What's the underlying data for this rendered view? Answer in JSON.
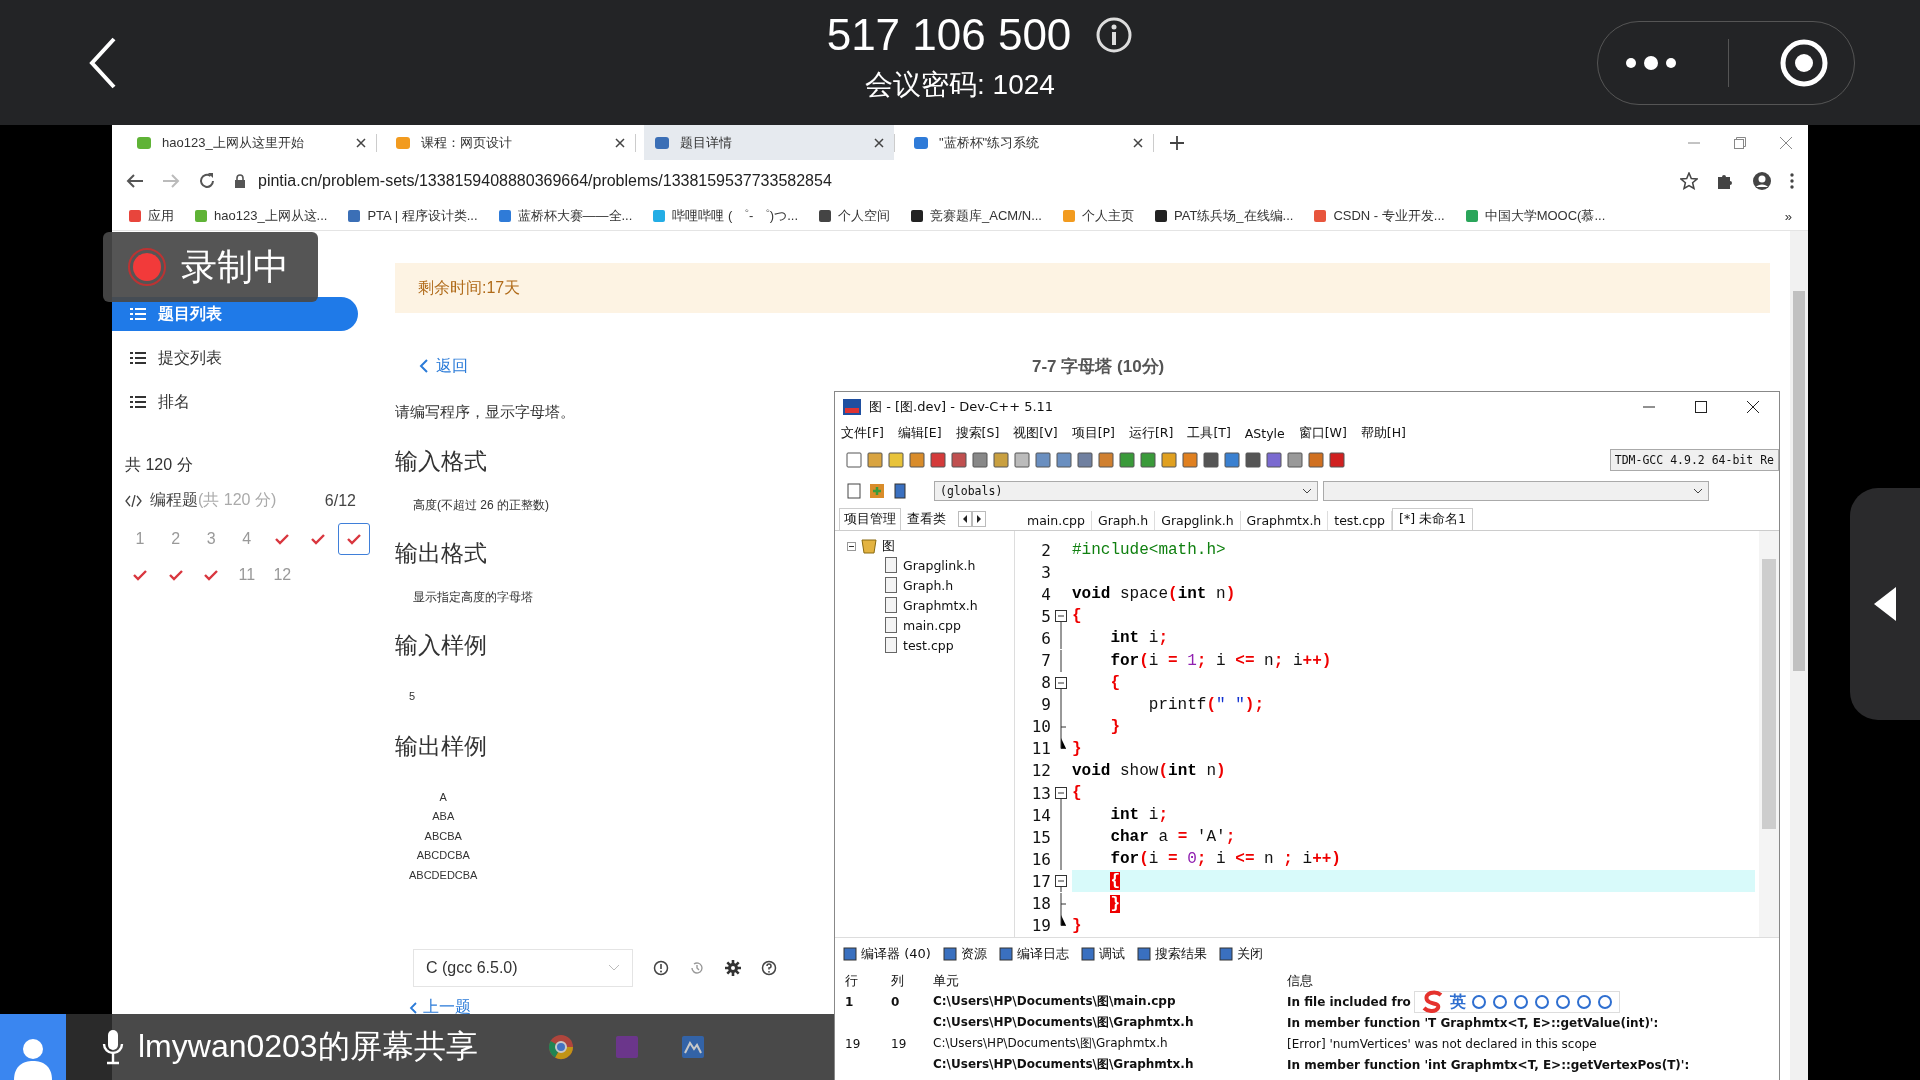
{
  "meeting": {
    "number": "517 106 500",
    "password": "会议密码: 1024"
  },
  "recording": {
    "label": "录制中"
  },
  "browser": {
    "tabs": [
      {
        "title": "hao123_上网从这里开始",
        "selected": false
      },
      {
        "title": "课程：网页设计",
        "selected": false
      },
      {
        "title": "题目详情",
        "selected": true
      },
      {
        "title": "\"蓝桥杯\"练习系统",
        "selected": false
      }
    ],
    "url": "pintia.cn/problem-sets/1338159408880369664/problems/1338159537733582854",
    "bookmarks": [
      {
        "title": "应用",
        "color": "#e8453c"
      },
      {
        "title": "hao123_上网从这...",
        "color": "#5fb336"
      },
      {
        "title": "PTA | 程序设计类...",
        "color": "#3b6fb6"
      },
      {
        "title": "蓝桥杯大赛——全...",
        "color": "#2f7bd8"
      },
      {
        "title": "哔哩哔哩 ( ゜- ゜)つ...",
        "color": "#23ade5"
      },
      {
        "title": "个人空间",
        "color": "#444444"
      },
      {
        "title": "竞赛题库_ACM/N...",
        "color": "#222222"
      },
      {
        "title": "个人主页",
        "color": "#f29b1f"
      },
      {
        "title": "PAT练兵场_在线编...",
        "color": "#222222"
      },
      {
        "title": "CSDN - 专业开发...",
        "color": "#e8553d"
      },
      {
        "title": "中国大学MOOC(慕...",
        "color": "#2aa55a"
      }
    ],
    "more": "»"
  },
  "sidebar": {
    "items": [
      {
        "label": "题目列表",
        "selected": true
      },
      {
        "label": "提交列表",
        "selected": false
      },
      {
        "label": "排名",
        "selected": false
      }
    ],
    "total": "共 120 分",
    "section": {
      "title": "编程题",
      "score": "(共 120 分)",
      "progress": "6/12"
    },
    "problems": [
      {
        "label": "1",
        "solved": false,
        "selected": false
      },
      {
        "label": "2",
        "solved": false,
        "selected": false
      },
      {
        "label": "3",
        "solved": false,
        "selected": false
      },
      {
        "label": "4",
        "solved": false,
        "selected": false
      },
      {
        "solved": true,
        "selected": false
      },
      {
        "solved": true,
        "selected": false
      },
      {
        "solved": true,
        "selected": true
      },
      {
        "solved": true,
        "selected": false
      },
      {
        "solved": true,
        "selected": false
      },
      {
        "solved": true,
        "selected": false
      },
      {
        "label": "11",
        "solved": false,
        "selected": false
      },
      {
        "label": "12",
        "solved": false,
        "selected": false
      }
    ]
  },
  "problem": {
    "notice": "剩余时间:17天",
    "back": "返回",
    "title": "7-7 字母塔 (10分)",
    "description": "请编写程序，显示字母塔。",
    "sections": [
      {
        "heading": "输入格式",
        "kind": "text",
        "lines": [
          "高度(不超过 26 的正整数)"
        ]
      },
      {
        "heading": "输出格式",
        "kind": "text",
        "lines": [
          "显示指定高度的字母塔"
        ]
      },
      {
        "heading": "输入样例",
        "kind": "sample",
        "lines": [
          "5"
        ]
      },
      {
        "heading": "输出样例",
        "kind": "sample",
        "lines": [
          "A",
          "ABA",
          "ABCBA",
          "ABCDCBA",
          "ABCDEDCBA"
        ]
      }
    ],
    "language": "C (gcc 6.5.0)",
    "prev": "上一题"
  },
  "devcpp": {
    "title": "图 - [图.dev] - Dev-C++ 5.11",
    "menu": [
      "文件[F]",
      "编辑[E]",
      "搜索[S]",
      "视图[V]",
      "项目[P]",
      "运行[R]",
      "工具[T]",
      "AStyle",
      "窗口[W]",
      "帮助[H]"
    ],
    "compiler": "TDM-GCC 4.9.2 64-bit Re",
    "scope": "(globals)",
    "panel_tabs": [
      {
        "label": "项目管理",
        "selected": true
      },
      {
        "label": "查看类",
        "selected": false
      }
    ],
    "file_tabs": [
      {
        "label": "main.cpp",
        "selected": false
      },
      {
        "label": "Graph.h",
        "selected": false
      },
      {
        "label": "Grapglink.h",
        "selected": false
      },
      {
        "label": "Graphmtx.h",
        "selected": false
      },
      {
        "label": "test.cpp",
        "selected": false
      },
      {
        "label": "[*] 未命名1",
        "selected": true
      }
    ],
    "tree": {
      "label": "图",
      "expanded": true,
      "children": [
        {
          "label": "Grapglink.h"
        },
        {
          "label": "Graph.h"
        },
        {
          "label": "Graphmtx.h"
        },
        {
          "label": "main.cpp"
        },
        {
          "label": "test.cpp"
        }
      ]
    },
    "code": [
      {
        "number": "2",
        "current": false,
        "tokens": [
          {
            "kind": "pre",
            "text": "#include<math.h>"
          }
        ]
      },
      {
        "number": "3",
        "current": false
      },
      {
        "number": "4",
        "current": false,
        "tokens": [
          {
            "kind": "kw",
            "text": "void"
          },
          {
            "kind": "id",
            "text": " space"
          },
          {
            "kind": "sym",
            "text": "("
          },
          {
            "kind": "kw",
            "text": "int"
          },
          {
            "kind": "id",
            "text": " n"
          },
          {
            "kind": "sym",
            "text": ")"
          }
        ]
      },
      {
        "number": "5",
        "kind": "open",
        "current": false,
        "tokens": [
          {
            "kind": "sym",
            "text": "{"
          }
        ]
      },
      {
        "number": "6",
        "kind": "line",
        "current": false,
        "tokens": [
          {
            "kind": "kw",
            "text": "    int"
          },
          {
            "kind": "id",
            "text": " i"
          },
          {
            "kind": "sym",
            "text": ";"
          }
        ]
      },
      {
        "number": "7",
        "kind": "line",
        "current": false,
        "tokens": [
          {
            "kind": "kw",
            "text": "    for"
          },
          {
            "kind": "sym",
            "text": "("
          },
          {
            "kind": "id",
            "text": "i "
          },
          {
            "kind": "sym",
            "text": "="
          },
          {
            "kind": "num",
            "text": " 1"
          },
          {
            "kind": "sym",
            "text": ";"
          },
          {
            "kind": "id",
            "text": " i "
          },
          {
            "kind": "sym",
            "text": "<="
          },
          {
            "kind": "id",
            "text": " n"
          },
          {
            "kind": "sym",
            "text": ";"
          },
          {
            "kind": "id",
            "text": " i"
          },
          {
            "kind": "sym",
            "text": "++"
          },
          {
            "kind": "sym",
            "text": ")"
          }
        ]
      },
      {
        "number": "8",
        "kind": "open",
        "current": false,
        "tokens": [
          {
            "kind": "sym",
            "text": "    {"
          }
        ]
      },
      {
        "number": "9",
        "kind": "line",
        "current": false,
        "tokens": [
          {
            "kind": "id",
            "text": "        printf"
          },
          {
            "kind": "sym",
            "text": "("
          },
          {
            "kind": "str",
            "text": "\" \""
          },
          {
            "kind": "sym",
            "text": ")"
          },
          {
            "kind": "sym",
            "text": ";"
          }
        ]
      },
      {
        "number": "10",
        "kind": "mid",
        "current": false,
        "tokens": [
          {
            "kind": "sym",
            "text": "    }"
          }
        ]
      },
      {
        "number": "11",
        "kind": "end",
        "current": false,
        "tokens": [
          {
            "kind": "sym",
            "text": "}"
          }
        ]
      },
      {
        "number": "12",
        "current": false,
        "tokens": [
          {
            "kind": "kw",
            "text": "void"
          },
          {
            "kind": "id",
            "text": " show"
          },
          {
            "kind": "sym",
            "text": "("
          },
          {
            "kind": "kw",
            "text": "int"
          },
          {
            "kind": "id",
            "text": " n"
          },
          {
            "kind": "sym",
            "text": ")"
          }
        ]
      },
      {
        "number": "13",
        "kind": "open",
        "current": false,
        "tokens": [
          {
            "kind": "sym",
            "text": "{"
          }
        ]
      },
      {
        "number": "14",
        "kind": "line",
        "current": false,
        "tokens": [
          {
            "kind": "kw",
            "text": "    int"
          },
          {
            "kind": "id",
            "text": " i"
          },
          {
            "kind": "sym",
            "text": ";"
          }
        ]
      },
      {
        "number": "15",
        "kind": "line",
        "current": false,
        "tokens": [
          {
            "kind": "kw",
            "text": "    char"
          },
          {
            "kind": "id",
            "text": " a "
          },
          {
            "kind": "sym",
            "text": "="
          },
          {
            "kind": "id",
            "text": " 'A'"
          },
          {
            "kind": "sym",
            "text": ";"
          }
        ]
      },
      {
        "number": "16",
        "kind": "line",
        "current": false,
        "tokens": [
          {
            "kind": "kw",
            "text": "    for"
          },
          {
            "kind": "sym",
            "text": "("
          },
          {
            "kind": "id",
            "text": "i "
          },
          {
            "kind": "sym",
            "text": "="
          },
          {
            "kind": "num",
            "text": " 0"
          },
          {
            "kind": "sym",
            "text": ";"
          },
          {
            "kind": "id",
            "text": " i "
          },
          {
            "kind": "sym",
            "text": "<="
          },
          {
            "kind": "id",
            "text": " n "
          },
          {
            "kind": "sym",
            "text": ";"
          },
          {
            "kind": "id",
            "text": " i"
          },
          {
            "kind": "sym",
            "text": "++"
          },
          {
            "kind": "sym",
            "text": ")"
          }
        ]
      },
      {
        "number": "17",
        "kind": "open",
        "current": true,
        "tokens": [
          {
            "kind": "match",
            "text": "    {"
          }
        ]
      },
      {
        "number": "18",
        "kind": "mid",
        "current": false,
        "tokens": [
          {
            "kind": "match",
            "text": "    }"
          }
        ]
      },
      {
        "number": "19",
        "kind": "end",
        "current": false,
        "tokens": [
          {
            "kind": "sym",
            "text": "}"
          }
        ]
      }
    ],
    "bottom_tabs": [
      "编译器 (40)",
      "资源",
      "编译日志",
      "调试",
      "搜索结果",
      "关闭"
    ],
    "messages": {
      "columns": [
        "行",
        "列",
        "单元",
        "信息"
      ],
      "rows": [
        {
          "kind": "note",
          "line": "1",
          "col": "0",
          "unit": "C:\\Users\\HP\\Documents\\图\\main.cpp",
          "info": "In file included fro"
        },
        {
          "kind": "note",
          "unit": "C:\\Users\\HP\\Documents\\图\\Graphmtx.h",
          "info": "In member function 'T Graphmtx<T, E>::getValue(int)':"
        },
        {
          "kind": "error",
          "line": "19",
          "col": "19",
          "unit": "C:\\Users\\HP\\Documents\\图\\Graphmtx.h",
          "info": "[Error] 'numVertices' was not declared in this scope"
        },
        {
          "kind": "note",
          "unit": "C:\\Users\\HP\\Documents\\图\\Graphmtx.h",
          "info": "In member function 'int Graphmtx<T, E>::getVertexPos(T)':"
        }
      ]
    }
  },
  "ime": {
    "mode": "英"
  },
  "share": {
    "label": "lmywan0203的屏幕共享"
  }
}
